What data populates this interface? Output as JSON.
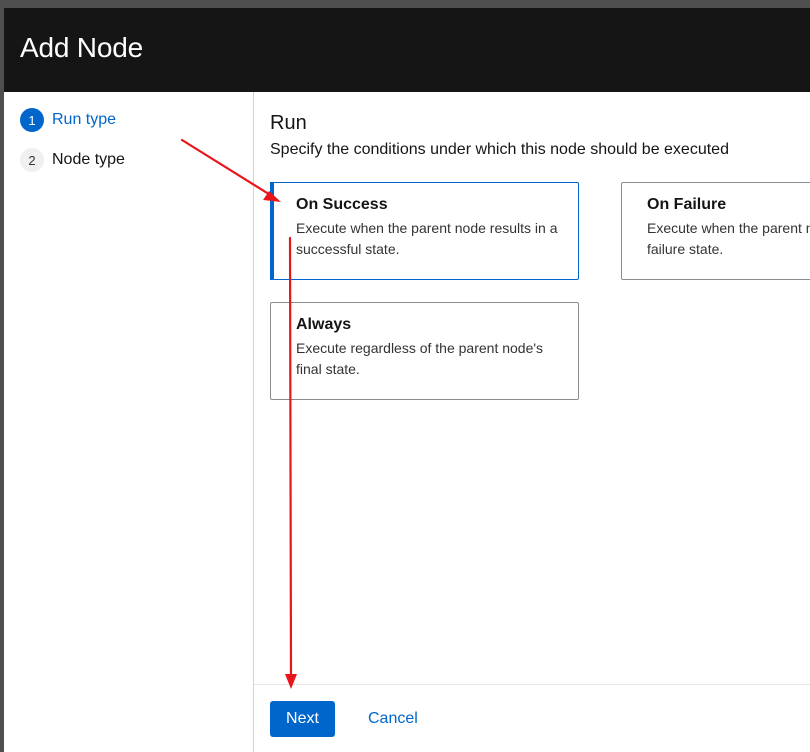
{
  "header": {
    "title": "Add Node"
  },
  "wizard": {
    "steps": [
      {
        "number": "1",
        "label": "Run type",
        "state": "active"
      },
      {
        "number": "2",
        "label": "Node type",
        "state": "inactive"
      }
    ]
  },
  "run": {
    "title": "Run",
    "description": "Specify the conditions under which this node should be executed",
    "options": [
      {
        "title": "On Success",
        "description": "Execute when the parent node results in a successful state.",
        "selected": true
      },
      {
        "title": "On Failure",
        "description": "Execute when the parent node results in a failure state.",
        "selected": false
      },
      {
        "title": "Always",
        "description": "Execute regardless of the parent node's final state.",
        "selected": false
      }
    ]
  },
  "footer": {
    "next_label": "Next",
    "cancel_label": "Cancel"
  },
  "colors": {
    "accent": "#0066cc",
    "header_bg": "#151515",
    "annotation": "#e8161b"
  }
}
